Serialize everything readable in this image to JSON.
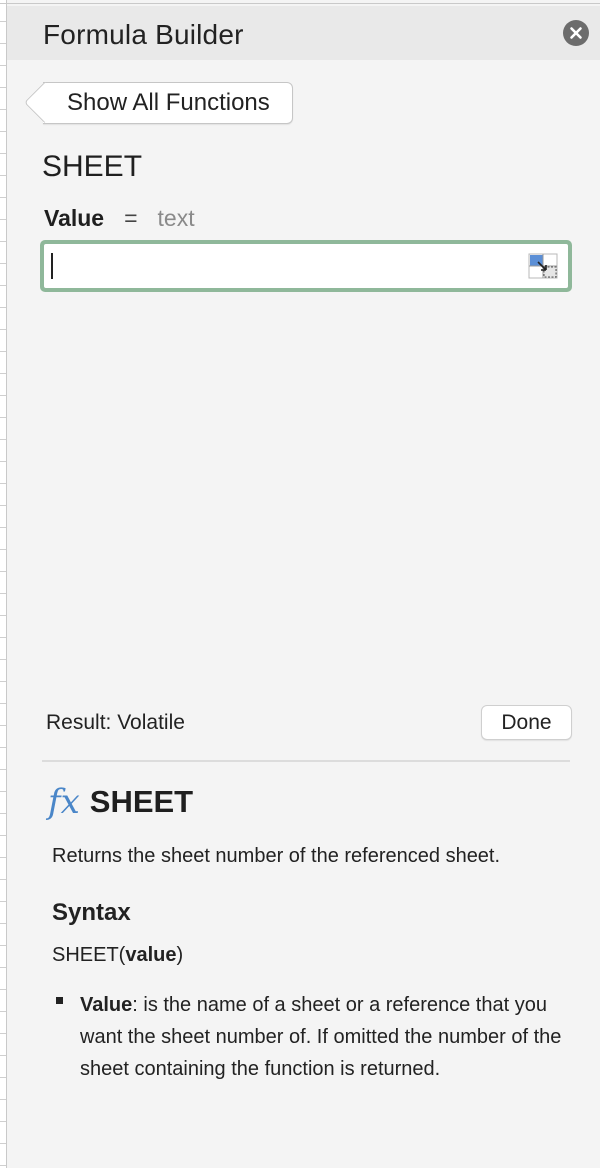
{
  "header": {
    "title": "Formula Builder"
  },
  "back_button": {
    "label": "Show All Functions"
  },
  "function": {
    "name": "SHEET",
    "argument": {
      "name": "Value",
      "equals": "=",
      "type": "text"
    },
    "input_value": ""
  },
  "result": {
    "label": "Result: Volatile"
  },
  "done_button": {
    "label": "Done"
  },
  "help": {
    "fx": "fx",
    "name": "SHEET",
    "description": "Returns the sheet number of the referenced sheet.",
    "syntax_heading": "Syntax",
    "syntax_prefix": "SHEET(",
    "syntax_arg": "value",
    "syntax_suffix": ")",
    "param_name": "Value",
    "param_desc": ": is the name of a sheet or a reference that you want the sheet number of.  If omitted the number of the sheet containing the function is returned."
  },
  "colors": {
    "input_focus": "#8fb89a",
    "fx_icon": "#4a86c8",
    "close_button": "#6c6c6c"
  }
}
